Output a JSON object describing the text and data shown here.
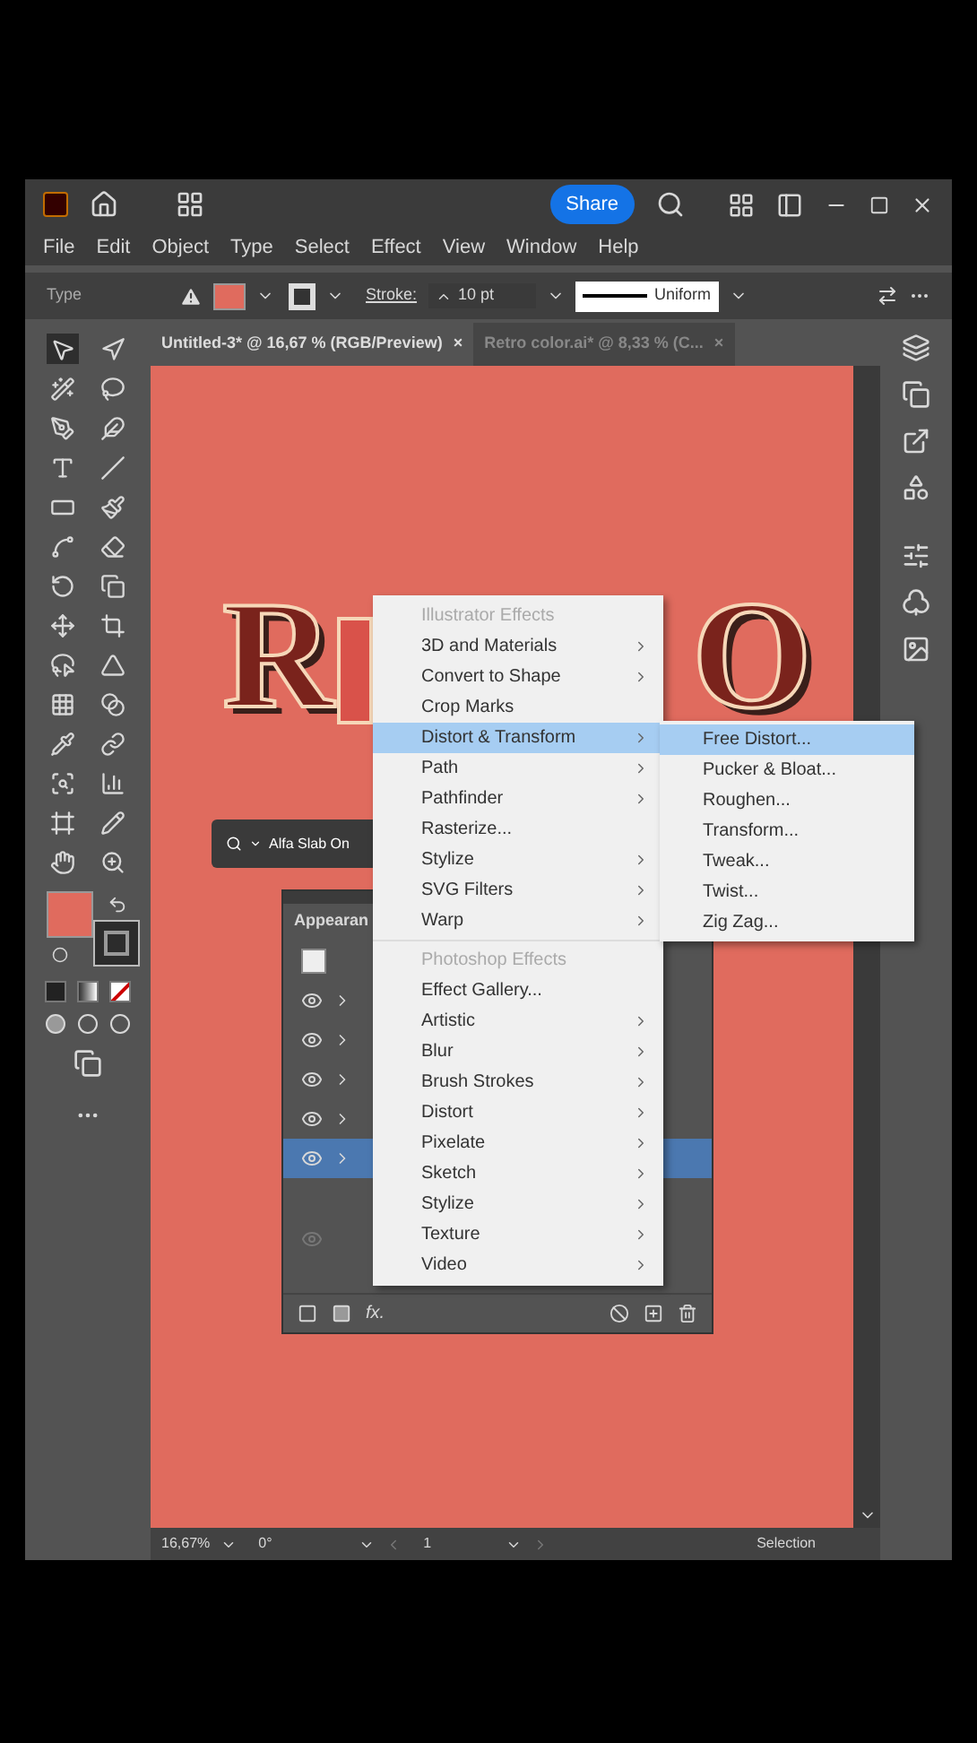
{
  "title_bar": {
    "share_button": "Share"
  },
  "menu_bar": [
    "File",
    "Edit",
    "Object",
    "Type",
    "Select",
    "Effect",
    "View",
    "Window",
    "Help"
  ],
  "control_bar": {
    "label": "Type",
    "stroke_label": "Stroke:",
    "stroke_weight": "10 pt",
    "profile": "Uniform"
  },
  "tabs": [
    {
      "label": "Untitled-3* @ 16,67 % (RGB/Preview)",
      "selected": true,
      "close": "×"
    },
    {
      "label": "Retro color.ai* @ 8,33 % (C...",
      "selected": false,
      "close": "×"
    }
  ],
  "artwork": {
    "letters": [
      "R",
      "O"
    ]
  },
  "font_search": {
    "value": "Alfa Slab On"
  },
  "appearance_panel": {
    "title": "Appearan",
    "fx_button": "fx.",
    "rows": [
      {
        "selected": false
      },
      {
        "selected": false
      },
      {
        "selected": false
      },
      {
        "selected": false
      },
      {
        "selected": true
      }
    ]
  },
  "effect_menu": {
    "items": [
      {
        "kind": "header",
        "label": "Illustrator Effects"
      },
      {
        "kind": "item",
        "label": "3D and Materials",
        "submenu": true,
        "selected": false
      },
      {
        "kind": "item",
        "label": "Convert to Shape",
        "submenu": true,
        "selected": false
      },
      {
        "kind": "item",
        "label": "Crop Marks",
        "submenu": false,
        "selected": false
      },
      {
        "kind": "item",
        "label": "Distort & Transform",
        "submenu": true,
        "selected": true
      },
      {
        "kind": "item",
        "label": "Path",
        "submenu": true,
        "selected": false
      },
      {
        "kind": "item",
        "label": "Pathfinder",
        "submenu": true,
        "selected": false
      },
      {
        "kind": "item",
        "label": "Rasterize...",
        "submenu": false,
        "selected": false
      },
      {
        "kind": "item",
        "label": "Stylize",
        "submenu": true,
        "selected": false
      },
      {
        "kind": "item",
        "label": "SVG Filters",
        "submenu": true,
        "selected": false
      },
      {
        "kind": "item",
        "label": "Warp",
        "submenu": true,
        "selected": false
      },
      {
        "kind": "separator"
      },
      {
        "kind": "header",
        "label": "Photoshop Effects"
      },
      {
        "kind": "item",
        "label": "Effect Gallery...",
        "submenu": false,
        "selected": false
      },
      {
        "kind": "item",
        "label": "Artistic",
        "submenu": true,
        "selected": false
      },
      {
        "kind": "item",
        "label": "Blur",
        "submenu": true,
        "selected": false
      },
      {
        "kind": "item",
        "label": "Brush Strokes",
        "submenu": true,
        "selected": false
      },
      {
        "kind": "item",
        "label": "Distort",
        "submenu": true,
        "selected": false
      },
      {
        "kind": "item",
        "label": "Pixelate",
        "submenu": true,
        "selected": false
      },
      {
        "kind": "item",
        "label": "Sketch",
        "submenu": true,
        "selected": false
      },
      {
        "kind": "item",
        "label": "Stylize",
        "submenu": true,
        "selected": false
      },
      {
        "kind": "item",
        "label": "Texture",
        "submenu": true,
        "selected": false
      },
      {
        "kind": "item",
        "label": "Video",
        "submenu": true,
        "selected": false
      }
    ]
  },
  "submenu": {
    "items": [
      {
        "label": "Free Distort...",
        "selected": true
      },
      {
        "label": "Pucker & Bloat...",
        "selected": false
      },
      {
        "label": "Roughen...",
        "selected": false
      },
      {
        "label": "Transform...",
        "selected": false
      },
      {
        "label": "Tweak...",
        "selected": false
      },
      {
        "label": "Twist...",
        "selected": false
      },
      {
        "label": "Zig Zag...",
        "selected": false
      }
    ]
  },
  "status_bar": {
    "zoom": "16,67%",
    "angle": "0°",
    "artboard": "1",
    "tool": "Selection"
  }
}
